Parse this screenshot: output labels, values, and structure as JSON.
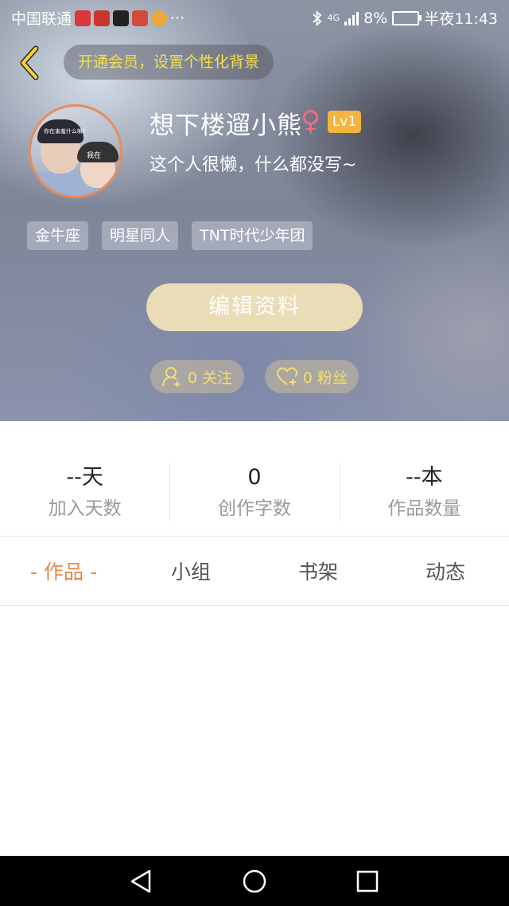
{
  "status_bar": {
    "carrier": "中国联通",
    "network": "4G",
    "battery": "8%",
    "time": "半夜11:43",
    "more": "···"
  },
  "header": {
    "vip_banner": "开通会员，设置个性化背景"
  },
  "profile": {
    "username": "想下楼遛小熊",
    "gender_symbol": "♀",
    "level": "Lv1",
    "bio": "这个人很懒，什么都没写~",
    "avatar_text_1": "你在害羞什么嘛?",
    "avatar_text_2": "我在"
  },
  "tags": [
    "金牛座",
    "明星同人",
    "TNT时代少年团"
  ],
  "edit_button": "编辑资料",
  "following": "0 关注",
  "fans": "0 粉丝",
  "stats": [
    {
      "value": "--天",
      "label": "加入天数"
    },
    {
      "value": "0",
      "label": "创作字数"
    },
    {
      "value": "--本",
      "label": "作品数量"
    }
  ],
  "tabs": [
    {
      "label": "- 作品 -",
      "active": true
    },
    {
      "label": "小组",
      "active": false
    },
    {
      "label": "书架",
      "active": false
    },
    {
      "label": "动态",
      "active": false
    }
  ],
  "colors": {
    "accent": "#e8874d",
    "vip_text": "#f6df4a",
    "level_badge": "#f3b53d",
    "edit_button": "#eadcb6",
    "gender": "#f26d7e"
  }
}
